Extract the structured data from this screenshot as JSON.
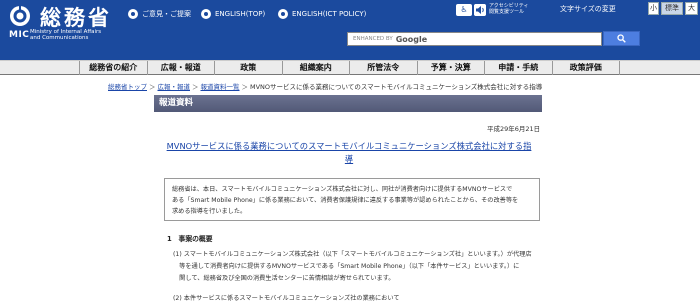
{
  "header": {
    "logo_jp": "総務省",
    "logo_mic": "MIC",
    "logo_en_line1": "Ministry of Internal Affairs",
    "logo_en_line2": "and Communications",
    "top_links": [
      "ご意見・ご提案",
      "ENGLISH(TOP)",
      "ENGLISH(ICT POLICY)"
    ],
    "accessibility_line1": "アクセシビリティ",
    "accessibility_line2": "閲覧支援ツール",
    "font_size_label": "文字サイズの変更",
    "font_size_options": [
      "小",
      "標準",
      "大"
    ],
    "search_enhanced": "ENHANCED BY",
    "search_google": "Google",
    "brand_color": "#1b4a9e",
    "search_button_icon": "search-icon"
  },
  "nav": {
    "items": [
      "総務省の紹介",
      "広報・報道",
      "政策",
      "組織案内",
      "所管法令",
      "予算・決算",
      "申請・手続",
      "政策評価"
    ]
  },
  "breadcrumb": {
    "items": [
      "総務省トップ",
      "広報・報道",
      "報道資料一覧"
    ],
    "current": "MVNOサービスに係る業務についてのスマートモバイルコミュニケーションズ株式会社に対する指導"
  },
  "page": {
    "section_title": "報道資料",
    "date": "平成29年6月21日",
    "title_line1": "MVNOサービスに係る業務についてのスマートモバイルコミュニケーションズ株式会社に対する指",
    "title_line2": "導",
    "summary_line1": "総務省は、本日、スマートモバイルコミュニケーションズ株式会社に対し、同社が消費者向けに提供するMVNOサービスで",
    "summary_line2": "ある「Smart Mobile Phone」に係る業務において、消費者保護規律に違反する事業等が認められたことから、その改善等を",
    "summary_line3": "求める指導を行いました。",
    "heading1": "1　事案の概要",
    "para1_line1": "(1) スマートモバイルコミュニケーションズ株式会社（以下「スマートモバイルコミュニケーションズ社」といいます。）が代理店",
    "para1_line2": "　等を通して消費者向けに提供するMVNOサービスである「Smart Mobile Phone」（以下「本件サービス」といいます。）に",
    "para1_line3": "　関して、総務省及び全国の消費生活センターに苦情相談が寄せられています。",
    "para2_line1": "(2) 本件サービスに係るスマートモバイルコミュニケーションズ社の業務において"
  }
}
